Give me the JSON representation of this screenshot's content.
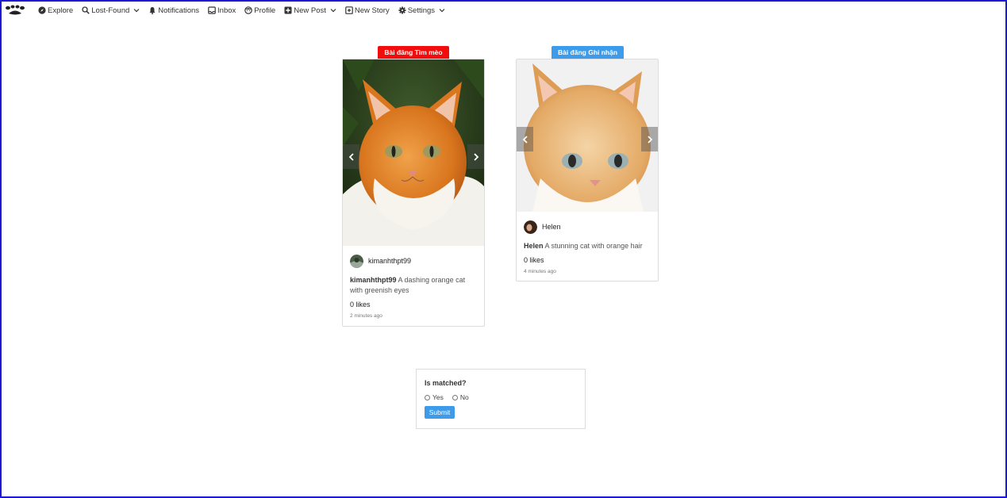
{
  "nav": {
    "logo_icon": "paw-logo-icon",
    "items": [
      {
        "label": "Explore",
        "icon": "compass-icon"
      },
      {
        "label": "Lost-Found",
        "icon": "search-icon",
        "dropdown": true
      },
      {
        "label": "Notifications",
        "icon": "bell-icon"
      },
      {
        "label": "Inbox",
        "icon": "inbox-icon"
      },
      {
        "label": "Profile",
        "icon": "face-icon"
      },
      {
        "label": "New Post",
        "icon": "plus-square-icon",
        "dropdown": true
      },
      {
        "label": "New Story",
        "icon": "story-icon"
      },
      {
        "label": "Settings",
        "icon": "gear-icon",
        "dropdown": true
      }
    ]
  },
  "posts": [
    {
      "badge": "Bài đăng Tìm mèo",
      "badge_color": "#f20d0d",
      "author": "kimanhthpt99",
      "caption_author": "kimanhthpt99",
      "caption": " A dashing orange cat with greenish eyes",
      "likes": "0 likes",
      "time": "2 minutes ago"
    },
    {
      "badge": "Bài đăng Ghi nhận",
      "badge_color": "#3d9be9",
      "author": "Helen",
      "caption_author": "Helen",
      "caption": " A stunning cat with orange hair",
      "likes": "0 likes",
      "time": "4 minutes ago"
    }
  ],
  "match_form": {
    "title": "Is matched?",
    "options": [
      "Yes",
      "No"
    ],
    "submit_label": "Submit",
    "accent": "#3d9be9"
  }
}
